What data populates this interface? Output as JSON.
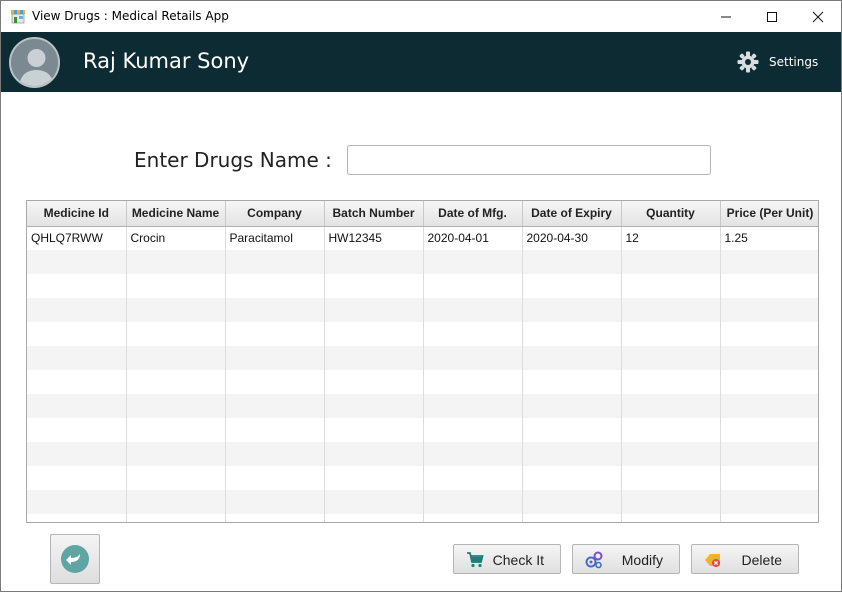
{
  "window": {
    "title": "View Drugs : Medical Retails App"
  },
  "header": {
    "user_name": "Raj Kumar Sony",
    "settings_label": "Settings"
  },
  "search": {
    "label": "Enter Drugs Name :",
    "value": "",
    "placeholder": ""
  },
  "table": {
    "columns": [
      "Medicine Id",
      "Medicine Name",
      "Company",
      "Batch Number",
      "Date of Mfg.",
      "Date of Expiry",
      "Quantity",
      "Price (Per Unit)"
    ],
    "rows": [
      [
        "QHLQ7RWW",
        "Crocin",
        "Paracitamol",
        "HW12345",
        "2020-04-01",
        "2020-04-30",
        "12",
        "1.25"
      ]
    ]
  },
  "buttons": {
    "check": "Check It",
    "modify": "Modify",
    "delete": "Delete"
  },
  "icons": {
    "app": "pharmacy-store-icon",
    "settings": "gear-icon",
    "back": "back-arrow-icon",
    "check": "shopping-cart-icon",
    "modify": "gears-icon",
    "delete": "tag-delete-icon"
  },
  "colors": {
    "header_bg": "#0d2b33",
    "back_icon": "#5fa5a3"
  }
}
